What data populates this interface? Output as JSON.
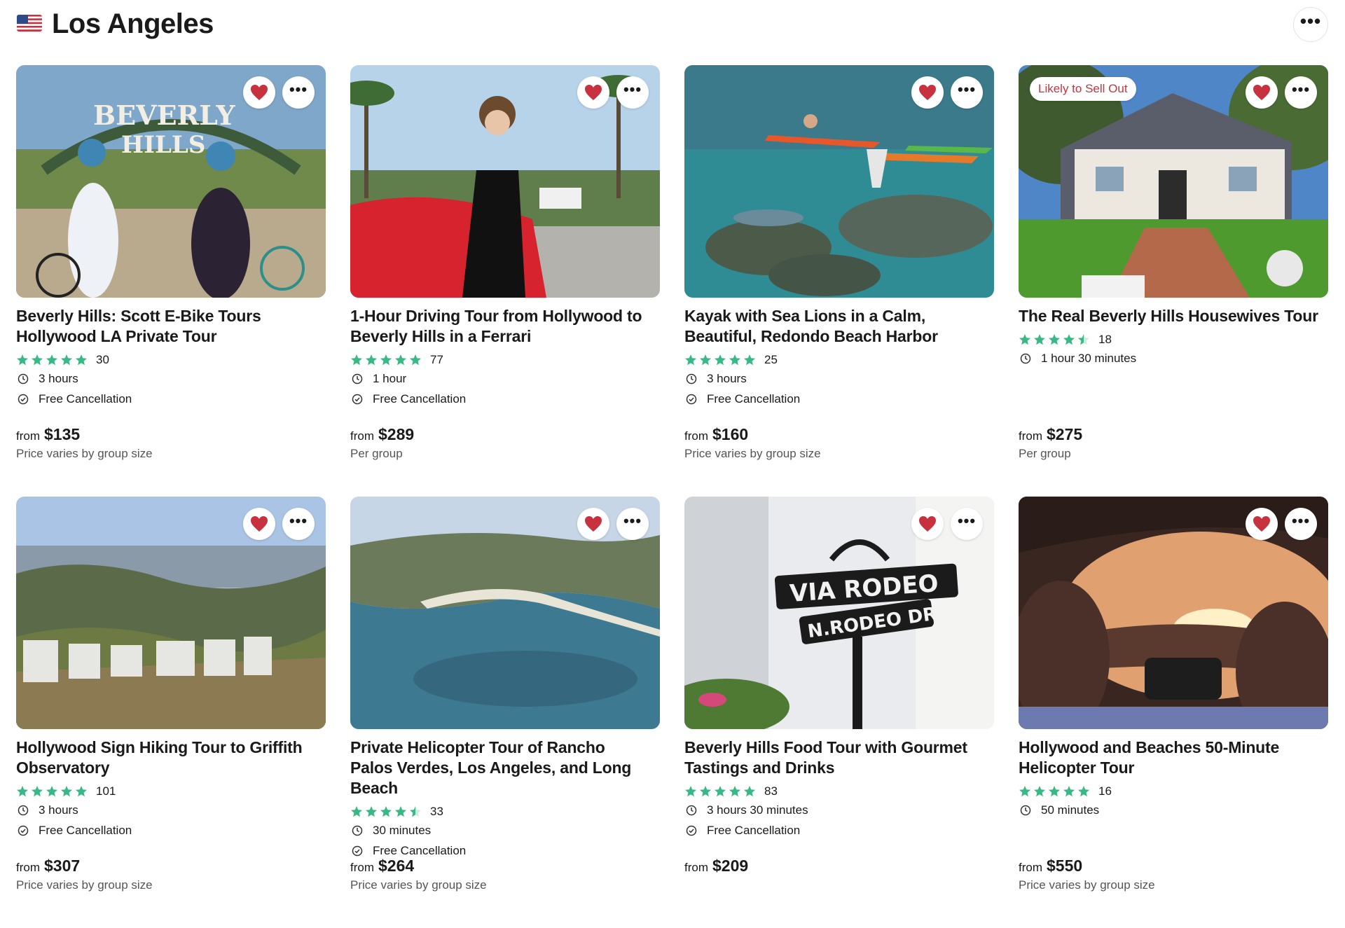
{
  "header": {
    "title": "Los Angeles",
    "flag_icon": "us-flag-icon",
    "more_icon": "more-horizontal-icon"
  },
  "colors": {
    "heart": "#c8323f",
    "star": "#38b885",
    "star_empty": "#cdebdc",
    "badge_text": "#c8323f"
  },
  "labels": {
    "from": "from"
  },
  "cards": [
    {
      "title": "Beverly Hills: Scott E-Bike Tours Hollywood LA Private Tour",
      "rating": 5,
      "reviews": "30",
      "duration": "3 hours",
      "cancellation": "Free Cancellation",
      "price": "$135",
      "price_note": "Price varies by group size",
      "badge": ""
    },
    {
      "title": "1-Hour Driving Tour from Hollywood to Beverly Hills in a Ferrari",
      "rating": 5,
      "reviews": "77",
      "duration": "1 hour",
      "cancellation": "Free Cancellation",
      "price": "$289",
      "price_note": "Per group",
      "badge": ""
    },
    {
      "title": "Kayak with Sea Lions in a Calm, Beautiful, Redondo Beach Harbor",
      "rating": 5,
      "reviews": "25",
      "duration": "3 hours",
      "cancellation": "Free Cancellation",
      "price": "$160",
      "price_note": "Price varies by group size",
      "badge": ""
    },
    {
      "title": "The Real Beverly Hills Housewives Tour",
      "rating": 4.5,
      "reviews": "18",
      "duration": "1 hour 30 minutes",
      "cancellation": "",
      "price": "$275",
      "price_note": "Per group",
      "badge": "Likely to Sell Out"
    },
    {
      "title": "Hollywood Sign Hiking Tour to Griffith Observatory",
      "rating": 5,
      "reviews": "101",
      "duration": "3 hours",
      "cancellation": "Free Cancellation",
      "price": "$307",
      "price_note": "Price varies by group size",
      "badge": ""
    },
    {
      "title": "Private Helicopter Tour of Rancho Palos Verdes, Los Angeles, and Long Beach",
      "rating": 4.5,
      "reviews": "33",
      "duration": "30 minutes",
      "cancellation": "Free Cancellation",
      "price": "$264",
      "price_note": "Price varies by group size",
      "badge": ""
    },
    {
      "title": "Beverly Hills Food Tour with Gourmet Tastings and Drinks",
      "rating": 5,
      "reviews": "83",
      "duration": "3 hours 30 minutes",
      "cancellation": "Free Cancellation",
      "price": "$209",
      "price_note": "",
      "badge": ""
    },
    {
      "title": "Hollywood and Beaches 50-Minute Helicopter Tour",
      "rating": 5,
      "reviews": "16",
      "duration": "50 minutes",
      "cancellation": "",
      "price": "$550",
      "price_note": "Price varies by group size",
      "badge": ""
    }
  ],
  "image_texts": [
    "BEVERLY",
    "HILLS",
    "VIA RODEO",
    "N.RODEO DR"
  ]
}
